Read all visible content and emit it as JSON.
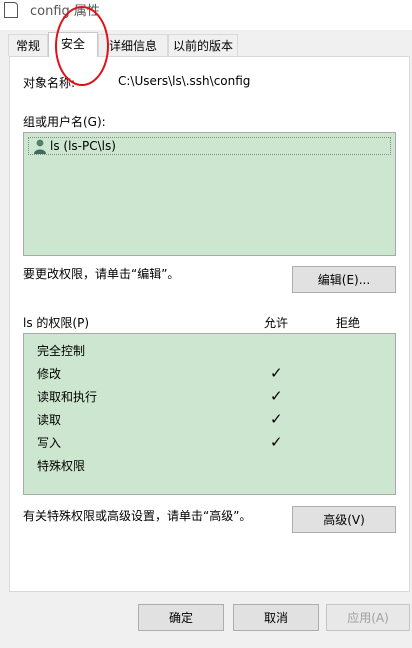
{
  "window": {
    "title": "config 属性"
  },
  "tabs": [
    {
      "label": "常规"
    },
    {
      "label": "安全"
    },
    {
      "label": "详细信息"
    },
    {
      "label": "以前的版本"
    }
  ],
  "security": {
    "object_name_label": "对象名称:",
    "object_name_value": "C:\\Users\\ls\\.ssh\\config",
    "group_label": "组或用户名(G):",
    "users": [
      {
        "name": "ls (ls-PC\\ls)",
        "icon": "user-icon"
      }
    ],
    "edit_hint": "要更改权限，请单击“编辑”。",
    "edit_button": "编辑(E)...",
    "perm_label": "ls 的权限(P)",
    "allow_header": "允许",
    "deny_header": "拒绝",
    "permissions": [
      {
        "name": "完全控制",
        "allow": false
      },
      {
        "name": "修改",
        "allow": true
      },
      {
        "name": "读取和执行",
        "allow": true
      },
      {
        "name": "读取",
        "allow": true
      },
      {
        "name": "写入",
        "allow": true
      },
      {
        "name": "特殊权限",
        "allow": false
      }
    ],
    "check_glyph": "✓",
    "advanced_hint": "有关特殊权限或高级设置，请单击“高级”。",
    "advanced_button": "高级(V)"
  },
  "footer": {
    "ok": "确定",
    "cancel": "取消",
    "apply": "应用(A)"
  },
  "colors": {
    "list_highlight": "#cde6cf",
    "annotation": "#e0101a"
  }
}
